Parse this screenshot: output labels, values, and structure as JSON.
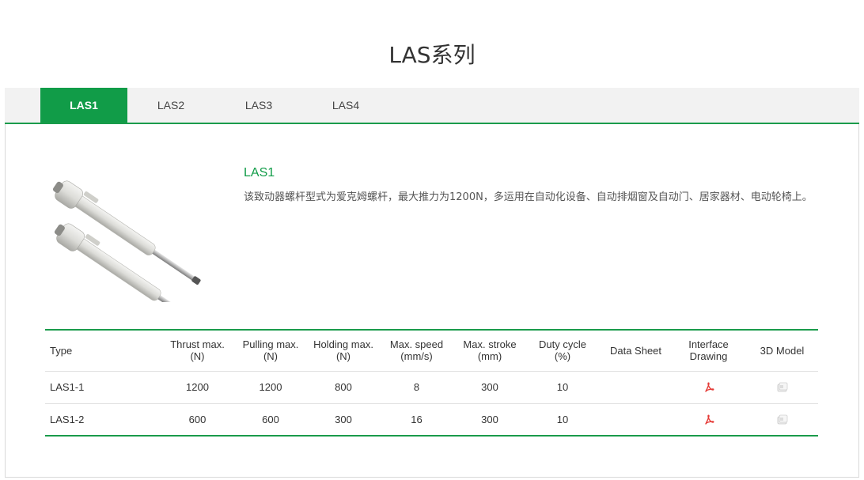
{
  "page": {
    "title": "LAS系列"
  },
  "tabs": [
    {
      "label": "LAS1",
      "active": true
    },
    {
      "label": "LAS2",
      "active": false
    },
    {
      "label": "LAS3",
      "active": false
    },
    {
      "label": "LAS4",
      "active": false
    }
  ],
  "product": {
    "name": "LAS1",
    "description": "该致动器螺杆型式为爱克姆螺杆，最大推力为1200N，多运用在自动化设备、自动排烟窗及自动门、居家器材、电动轮椅上。"
  },
  "table": {
    "headers": [
      {
        "line1": "Type",
        "line2": ""
      },
      {
        "line1": "Thrust max.",
        "line2": "(N)"
      },
      {
        "line1": "Pulling max.",
        "line2": "(N)"
      },
      {
        "line1": "Holding max.",
        "line2": "(N)"
      },
      {
        "line1": "Max. speed",
        "line2": "(mm/s)"
      },
      {
        "line1": "Max. stroke",
        "line2": "(mm)"
      },
      {
        "line1": "Duty cycle",
        "line2": "(%)"
      },
      {
        "line1": "Data Sheet",
        "line2": ""
      },
      {
        "line1": "Interface",
        "line2": "Drawing"
      },
      {
        "line1": "3D Model",
        "line2": ""
      }
    ],
    "rows": [
      {
        "type": "LAS1-1",
        "thrust": "1200",
        "pulling": "1200",
        "holding": "800",
        "speed": "8",
        "stroke": "300",
        "duty": "10",
        "interface_icon": "pdf-icon",
        "model_icon": "3d-model-icon"
      },
      {
        "type": "LAS1-2",
        "thrust": "600",
        "pulling": "600",
        "holding": "300",
        "speed": "16",
        "stroke": "300",
        "duty": "10",
        "interface_icon": "pdf-icon",
        "model_icon": "3d-model-icon"
      }
    ]
  },
  "colors": {
    "accent": "#119c48",
    "tab_bar": "#f2f2f2",
    "pdf": "#e53935"
  }
}
